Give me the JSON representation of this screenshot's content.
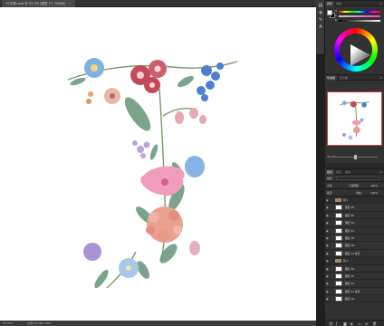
{
  "document": {
    "tab_label": "19字母t.psd @ 33.3% (图层 17, RGB/8)",
    "zoom": "33.33%",
    "doc_size": "文档:48.3M/1.48G"
  },
  "color_panel": {
    "tabs": [
      "颜色",
      "色板"
    ],
    "slider_labels": [
      "H",
      "S",
      "B"
    ],
    "foreground": "#ffffff",
    "background": "#000000"
  },
  "navigator": {
    "tabs": [
      "导航器",
      "直方图"
    ],
    "zoom": "33.33%"
  },
  "layers": {
    "tabs": [
      "图层",
      "通道",
      "路径"
    ],
    "filter_label": "类型",
    "blend_mode": "正常",
    "opacity_label": "不透明度:",
    "opacity_value": "100%",
    "lock_label": "锁定:",
    "fill_label": "填充:",
    "fill_value": "100%",
    "rows": [
      {
        "name": "组 1",
        "group": true
      },
      {
        "name": "图层 45",
        "group": false
      },
      {
        "name": "图层 20",
        "group": false
      },
      {
        "name": "图层 22",
        "group": false
      },
      {
        "name": "图层 21",
        "group": false
      },
      {
        "name": "图层 19",
        "group": false
      },
      {
        "name": "图层 18",
        "group": false
      },
      {
        "name": "图层 14 拷贝",
        "group": false
      },
      {
        "name": "组 2",
        "group": true
      },
      {
        "name": "图层 16",
        "group": false
      },
      {
        "name": "图层 15",
        "group": false
      },
      {
        "name": "图层 13",
        "group": false
      },
      {
        "name": "图层 11 拷贝",
        "group": false
      },
      {
        "name": "图层 10",
        "group": false
      }
    ],
    "footer_icons": [
      "link-icon",
      "fx-icon",
      "mask-icon",
      "adjustment-icon",
      "folder-icon",
      "new-layer-icon",
      "trash-icon"
    ]
  }
}
